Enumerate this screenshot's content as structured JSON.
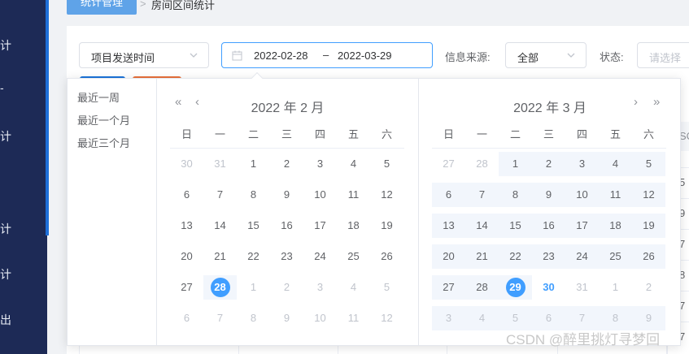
{
  "sidebar": {
    "items": [
      "计",
      "-",
      "计",
      "计",
      "计",
      "出"
    ]
  },
  "breadcrumb": {
    "section": "统计管理",
    "separator": ">",
    "current": "房间区间统计"
  },
  "filters": {
    "time_field": "项目发送时间",
    "range_start": "2022-02-28",
    "range_sep": "–",
    "range_end": "2022-03-29",
    "source_label": "信息来源:",
    "source_value": "全部",
    "status_label": "状态:",
    "status_placeholder": "请选择"
  },
  "picker": {
    "shortcuts": [
      "最近一周",
      "最近一个月",
      "最近三个月"
    ],
    "weekdays": [
      "日",
      "一",
      "二",
      "三",
      "四",
      "五",
      "六"
    ],
    "left": {
      "title": "2022 年 2 月",
      "days": [
        [
          "30",
          "31",
          "1",
          "2",
          "3",
          "4",
          "5"
        ],
        [
          "6",
          "7",
          "8",
          "9",
          "10",
          "11",
          "12"
        ],
        [
          "13",
          "14",
          "15",
          "16",
          "17",
          "18",
          "19"
        ],
        [
          "20",
          "21",
          "22",
          "23",
          "24",
          "25",
          "26"
        ],
        [
          "27",
          "28",
          "1",
          "2",
          "3",
          "4",
          "5"
        ],
        [
          "6",
          "7",
          "8",
          "9",
          "10",
          "11",
          "12"
        ]
      ]
    },
    "right": {
      "title": "2022 年 3 月",
      "days": [
        [
          "27",
          "28",
          "1",
          "2",
          "3",
          "4",
          "5"
        ],
        [
          "6",
          "7",
          "8",
          "9",
          "10",
          "11",
          "12"
        ],
        [
          "13",
          "14",
          "15",
          "16",
          "17",
          "18",
          "19"
        ],
        [
          "20",
          "21",
          "22",
          "23",
          "24",
          "25",
          "26"
        ],
        [
          "27",
          "28",
          "29",
          "30",
          "31",
          "1",
          "2"
        ],
        [
          "3",
          "4",
          "5",
          "6",
          "7",
          "8",
          "9"
        ]
      ]
    },
    "nav": {
      "prev_year": "«",
      "prev_month": "‹",
      "next_month": "›",
      "next_year": "»"
    }
  },
  "table_peek": {
    "header": "SC",
    "cells": [
      "5",
      "9",
      "7",
      "8",
      "7",
      "7"
    ]
  },
  "watermark": "CSDN @醉里挑灯寻梦回",
  "colors": {
    "accent": "#409eff",
    "sidebar": "#1d2a56",
    "range_bg": "#f2f6fc",
    "muted": "#c0c4cc"
  }
}
